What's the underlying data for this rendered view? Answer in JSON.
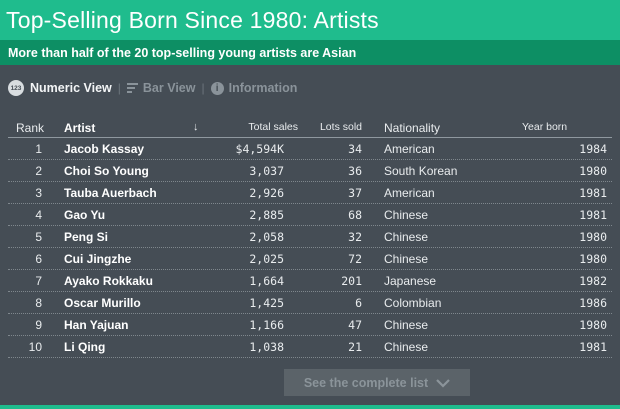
{
  "header": {
    "title": "Top-Selling Born Since 1980: Artists"
  },
  "subheader": {
    "text": "More than half of the 20 top-selling young artists are Asian"
  },
  "toolbar": {
    "badge": "123",
    "numeric_view": "Numeric View",
    "separator": "|",
    "bar_view": "Bar View",
    "information": "Information"
  },
  "table": {
    "columns": {
      "rank": "Rank",
      "artist": "Artist",
      "sort_arrow": "↓",
      "total_sales": "Total sales",
      "lots_sold": "Lots sold",
      "nationality": "Nationality",
      "year_born": "Year born"
    },
    "rows": [
      {
        "rank": "1",
        "artist": "Jacob Kassay",
        "sales": "$4,594K",
        "lots": "34",
        "nationality": "American",
        "year": "1984"
      },
      {
        "rank": "2",
        "artist": "Choi So Young",
        "sales": "3,037",
        "lots": "36",
        "nationality": "South Korean",
        "year": "1980"
      },
      {
        "rank": "3",
        "artist": "Tauba Auerbach",
        "sales": "2,926",
        "lots": "37",
        "nationality": "American",
        "year": "1981"
      },
      {
        "rank": "4",
        "artist": "Gao Yu",
        "sales": "2,885",
        "lots": "68",
        "nationality": "Chinese",
        "year": "1981"
      },
      {
        "rank": "5",
        "artist": "Peng Si",
        "sales": "2,058",
        "lots": "32",
        "nationality": "Chinese",
        "year": "1980"
      },
      {
        "rank": "6",
        "artist": "Cui Jingzhe",
        "sales": "2,025",
        "lots": "72",
        "nationality": "Chinese",
        "year": "1980"
      },
      {
        "rank": "7",
        "artist": "Ayako Rokkaku",
        "sales": "1,664",
        "lots": "201",
        "nationality": "Japanese",
        "year": "1982"
      },
      {
        "rank": "8",
        "artist": "Oscar Murillo",
        "sales": "1,425",
        "lots": "6",
        "nationality": "Colombian",
        "year": "1986"
      },
      {
        "rank": "9",
        "artist": "Han Yajuan",
        "sales": "1,166",
        "lots": "47",
        "nationality": "Chinese",
        "year": "1980"
      },
      {
        "rank": "10",
        "artist": "Li Qing",
        "sales": "1,038",
        "lots": "21",
        "nationality": "Chinese",
        "year": "1981"
      }
    ]
  },
  "more_button": {
    "label": "See the complete list"
  },
  "colors": {
    "header": "#1fbc8d",
    "subheader": "#0d8f64",
    "background": "#454d55"
  }
}
